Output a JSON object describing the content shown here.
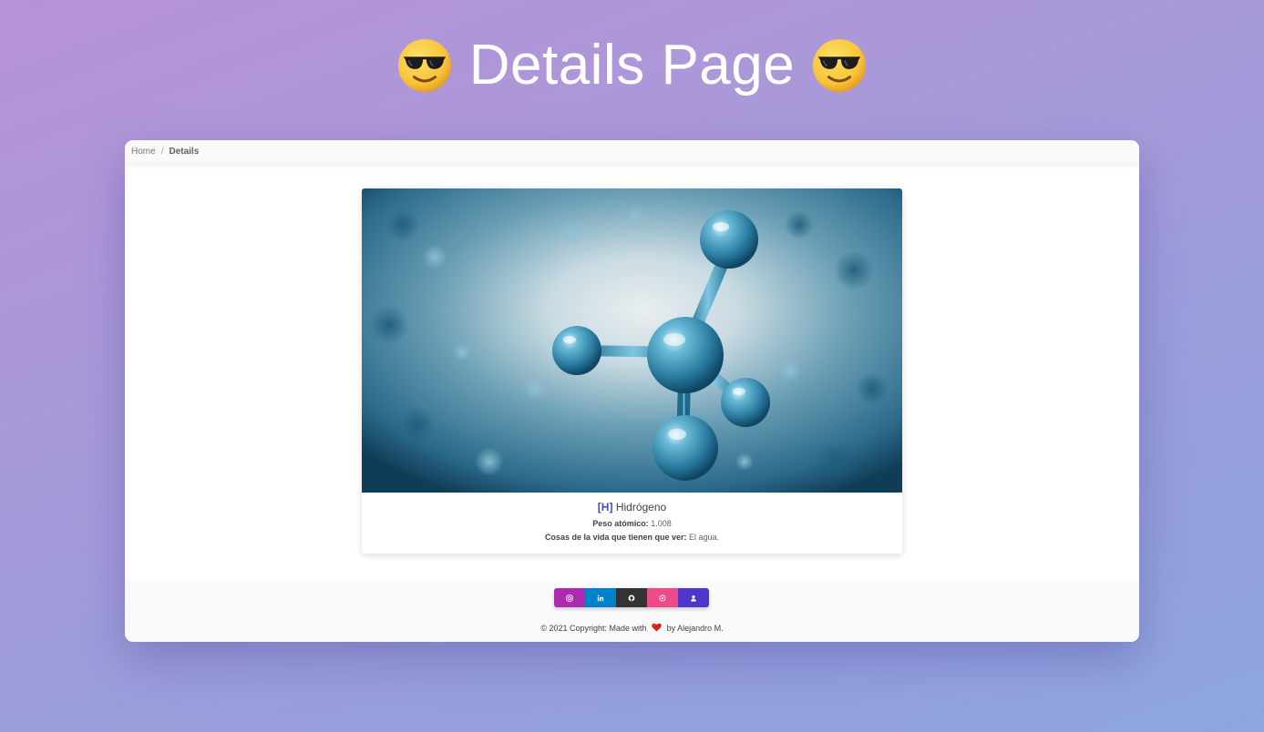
{
  "header": {
    "title": "Details Page",
    "emoji_icon": "smiling-face-with-sunglasses"
  },
  "breadcrumb": {
    "home": "Home",
    "separator": "/",
    "current": "Details"
  },
  "element": {
    "symbol": "[H]",
    "name": "Hidrógeno",
    "weight_label": "Peso atómico:",
    "weight_value": "1.008",
    "life_label": "Cosas de la vida que tienen que ver:",
    "life_value": "El agua.",
    "image_icon": "molecule-image"
  },
  "footer": {
    "social": [
      {
        "name": "instagram",
        "icon": "instagram-icon",
        "color": "#ac2bac"
      },
      {
        "name": "linkedin",
        "icon": "linkedin-icon",
        "color": "#0082ca"
      },
      {
        "name": "github",
        "icon": "github-icon",
        "color": "#333333"
      },
      {
        "name": "dribbble",
        "icon": "dribbble-icon",
        "color": "#ec4a89"
      },
      {
        "name": "profile",
        "icon": "user-icon",
        "color": "#4f35c9"
      }
    ],
    "copyright_prefix": "© 2021 Copyright:",
    "made_with": "Made with",
    "by_author": "by Alejandro M."
  }
}
